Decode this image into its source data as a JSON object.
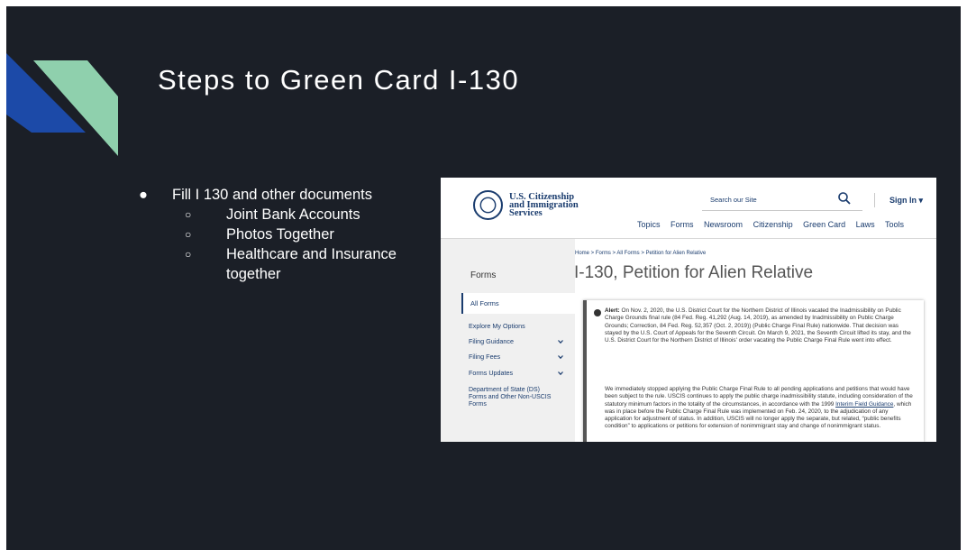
{
  "slide": {
    "title": "Steps to Green Card I-130",
    "bullet": "Fill I 130 and other documents",
    "bullet_marker": "●",
    "sub_marker": "○",
    "sub_items": [
      "Joint Bank Accounts",
      "Photos Together",
      "Healthcare and Insurance together"
    ],
    "deco_colors": [
      "#1c4aa8",
      "#8fd0ad"
    ]
  },
  "uscis": {
    "agency_lines": [
      "U.S. Citizenship",
      "and Immigration",
      "Services"
    ],
    "search_placeholder": "Search our Site",
    "signin": "Sign In ▾",
    "nav": [
      "Topics",
      "Forms",
      "Newsroom",
      "Citizenship",
      "Green Card",
      "Laws",
      "Tools"
    ],
    "breadcrumbs": "Home > Forms > All Forms > Petition for Alien Relative",
    "page_title": "I-130, Petition for Alien Relative",
    "sidebar": {
      "heading": "Forms",
      "active": "All Forms",
      "items": [
        "Explore My Options",
        "Filing Guidance",
        "Filing Fees",
        "Forms Updates"
      ],
      "ds": "Department of State (DS) Forms and Other Non-USCIS Forms"
    },
    "alert": {
      "label": "Alert:",
      "p1": "On Nov. 2, 2020, the U.S. District Court for the Northern District of Illinois vacated the Inadmissibility on Public Charge Grounds final rule (84 Fed. Reg. 41,292 (Aug. 14, 2019), as amended by Inadmissibility on Public Charge Grounds; Correction, 84 Fed. Reg. 52,357 (Oct. 2, 2019)) (Public Charge Final Rule) nationwide. That decision was stayed by the U.S. Court of Appeals for the Seventh Circuit. On March 9, 2021, the Seventh Circuit lifted its stay, and the U.S. District Court for the Northern District of Illinois' order vacating the Public Charge Final Rule went into effect.",
      "p2a": "We immediately stopped applying the Public Charge Final Rule to all pending applications and petitions that would have been subject to the rule. USCIS continues to apply the public charge inadmissibility statute, including consideration of the statutory minimum factors in the totality of the circumstances, in accordance with the 1999 ",
      "p2link": "Interim Field Guidance",
      "p2b": ", which was in place before the Public Charge Final Rule was implemented on Feb. 24, 2020, to the adjudication of any application for adjustment of status. In addition, USCIS will no longer apply the separate, but related, “public benefits condition” to applications or petitions for extension of nonimmigrant stay and change of nonimmigrant status."
    }
  }
}
